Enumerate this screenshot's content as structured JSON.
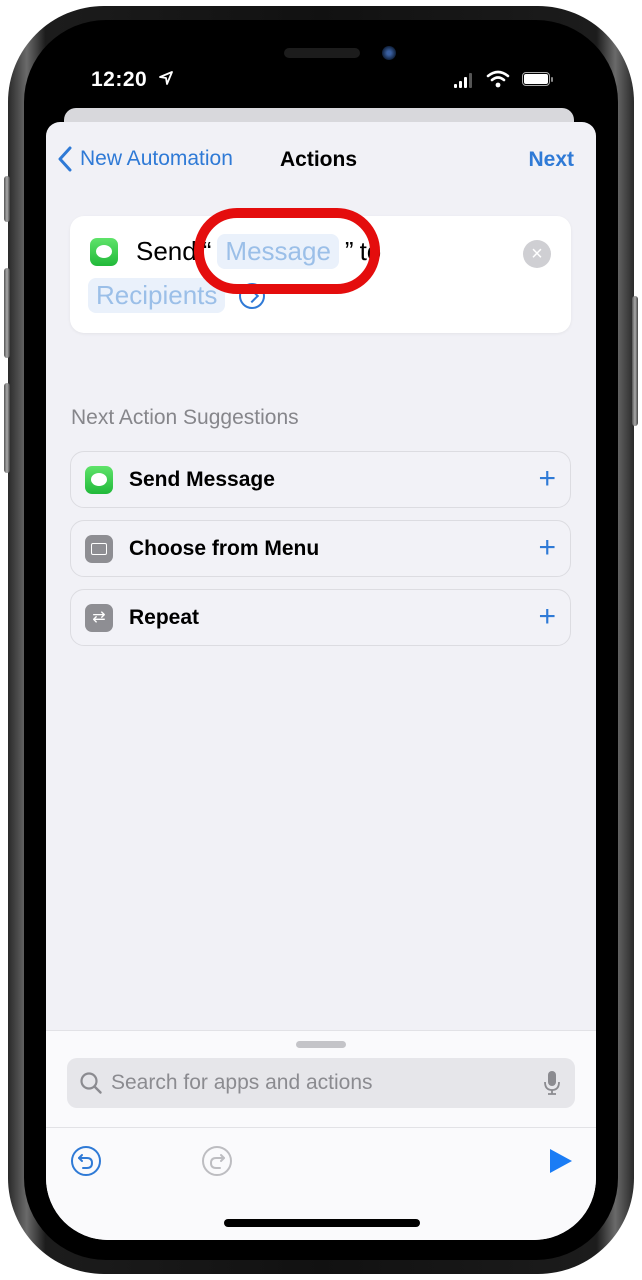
{
  "status_bar": {
    "time": "12:20",
    "location_icon": "location-arrow-icon",
    "signal_icon": "cellular-signal-icon",
    "wifi_icon": "wifi-icon",
    "battery_icon": "battery-icon"
  },
  "nav": {
    "back_label": "New Automation",
    "title": "Actions",
    "next_label": "Next"
  },
  "action_card": {
    "verb": "Send",
    "open_quote": "“",
    "message_placeholder": "Message",
    "close_quote": "”",
    "connector": "to",
    "recipients_placeholder": "Recipients",
    "remove_icon": "×"
  },
  "suggestions": {
    "header": "Next Action Suggestions",
    "items": [
      {
        "label": "Send Message",
        "icon": "messages-icon"
      },
      {
        "label": "Choose from Menu",
        "icon": "menu-icon"
      },
      {
        "label": "Repeat",
        "icon": "repeat-icon"
      }
    ],
    "add_symbol": "+"
  },
  "search": {
    "placeholder": "Search for apps and actions"
  },
  "colors": {
    "accent": "#2f7ad6",
    "highlight_annotation": "#e40d0d",
    "messages_green": "#21b93a"
  }
}
